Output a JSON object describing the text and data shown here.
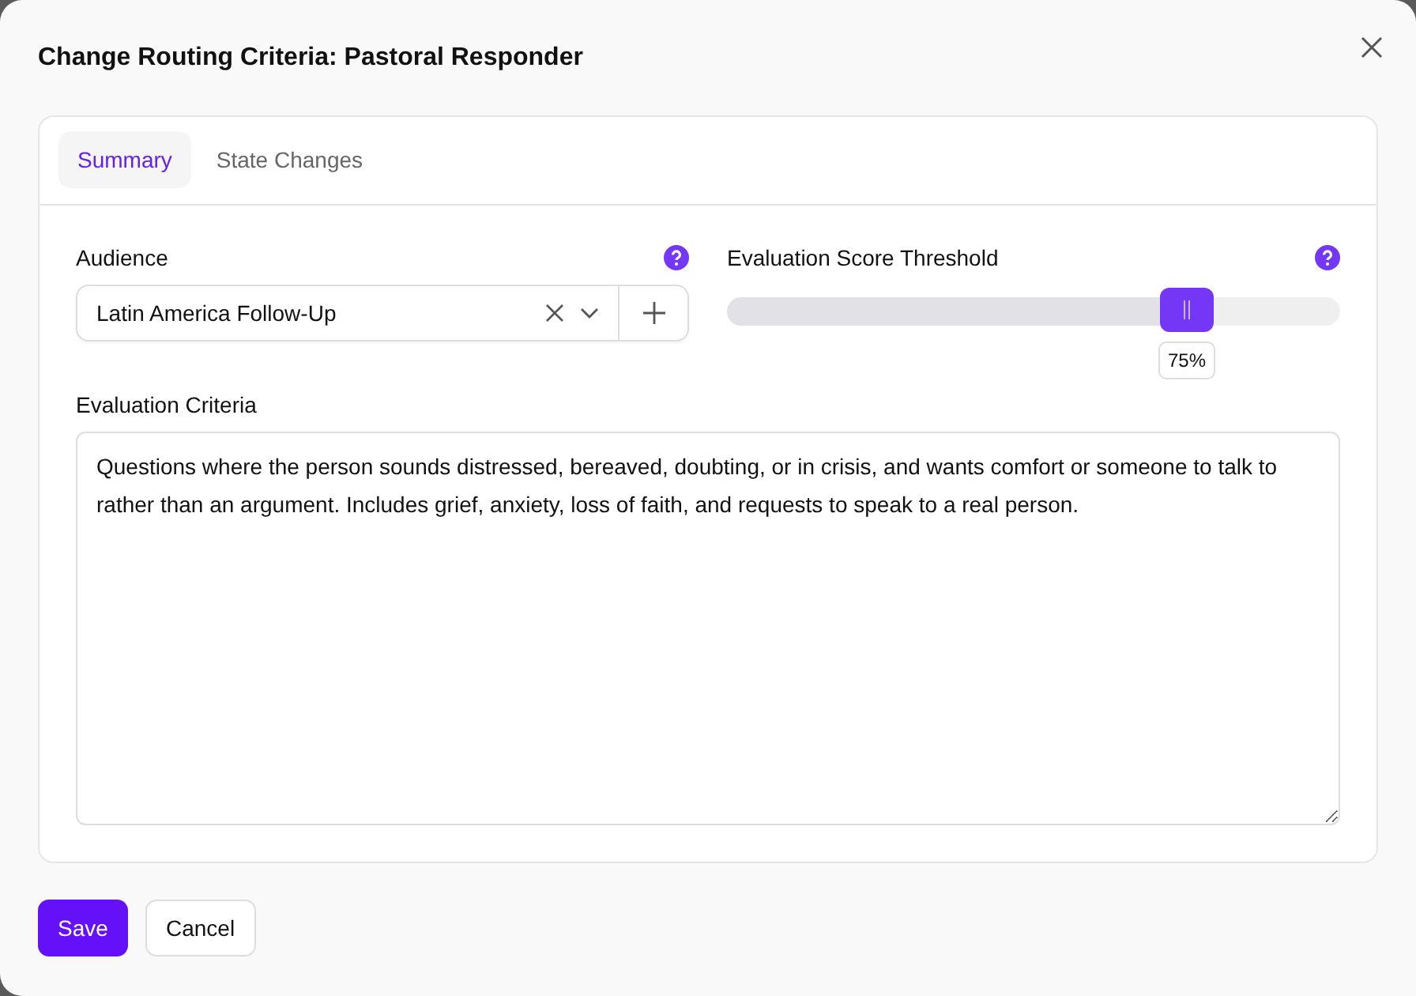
{
  "dialog": {
    "title": "Change Routing Criteria: Pastoral Responder"
  },
  "tabs": [
    {
      "label": "Summary",
      "selected": true
    },
    {
      "label": "State Changes",
      "selected": false
    }
  ],
  "audience": {
    "label": "Audience",
    "value": "Latin America Follow-Up"
  },
  "threshold": {
    "label": "Evaluation Score Threshold",
    "level": 0.75,
    "reading": "75%"
  },
  "criteria": {
    "label": "Evaluation Criteria",
    "value": "Questions where the person sounds distressed, bereaved, doubting, or in crisis, and wants comfort or someone to talk to rather than an argument. Includes grief, anxiety, loss of faith, and requests to speak to a real person."
  },
  "buttons": [
    {
      "label": "Save",
      "kind": "primary"
    },
    {
      "label": "Cancel",
      "kind": "secondary"
    }
  ]
}
